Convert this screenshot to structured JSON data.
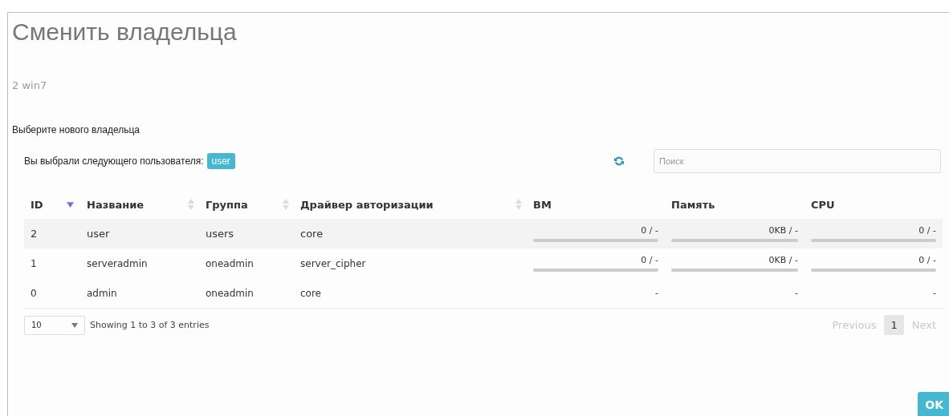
{
  "dialog": {
    "title": "Сменить владельца",
    "subtitle": "2 win7",
    "prompt": "Выберите нового владельца"
  },
  "selection": {
    "label": "Вы выбрали следующего пользователя:",
    "badge": "user"
  },
  "search": {
    "placeholder": "Поиск"
  },
  "table": {
    "columns": [
      {
        "label": "ID",
        "sorted": true
      },
      {
        "label": "Название",
        "sorted": false
      },
      {
        "label": "Группа",
        "sorted": false
      },
      {
        "label": "Драйвер авторизации",
        "sorted": false
      },
      {
        "label": "ВМ"
      },
      {
        "label": "Память"
      },
      {
        "label": "CPU"
      }
    ],
    "rows": [
      {
        "selected": true,
        "cells": [
          {
            "text": "2"
          },
          {
            "text": "user"
          },
          {
            "text": "users"
          },
          {
            "text": "core"
          },
          {
            "text": "0 / -",
            "level": 0
          },
          {
            "text": "0KB / -",
            "level": 0
          },
          {
            "text": "0 / -",
            "level": 0
          }
        ]
      },
      {
        "selected": false,
        "cells": [
          {
            "text": "1"
          },
          {
            "text": "serveradmin"
          },
          {
            "text": "oneadmin"
          },
          {
            "text": "server_cipher"
          },
          {
            "text": "0 / -",
            "level": 0
          },
          {
            "text": "0KB / -",
            "level": 0
          },
          {
            "text": "0 / -",
            "level": 0
          }
        ]
      },
      {
        "selected": false,
        "cells": [
          {
            "text": "0"
          },
          {
            "text": "admin"
          },
          {
            "text": "oneadmin"
          },
          {
            "text": "core"
          },
          {
            "text": "-"
          },
          {
            "text": "-"
          },
          {
            "text": "-"
          }
        ]
      }
    ]
  },
  "footer": {
    "page_size": "10",
    "info": "Showing 1 to 3 of 3 entries",
    "previous": {
      "label": "Previous",
      "disabled": true
    },
    "pages": [
      {
        "label": "1",
        "selected": true
      }
    ],
    "next": {
      "label": "Next",
      "disabled": true
    }
  },
  "ok_button": "OK"
}
